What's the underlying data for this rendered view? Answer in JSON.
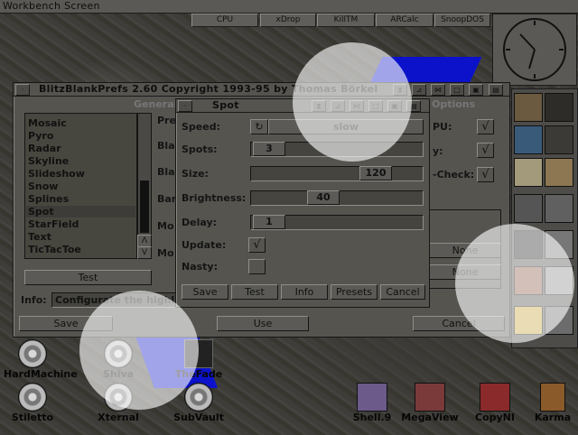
{
  "screen": {
    "title": "Workbench Screen"
  },
  "dock_buttons": [
    "CPU",
    "xDrop",
    "KillTM",
    "ARCalc",
    "SnoopDOS"
  ],
  "main_window": {
    "title": "BlitzBlankPrefs 2.60  Copyright 1993-95 by Thomas Börkel",
    "section_general": "General",
    "section_options": "Options",
    "modules": [
      "Mosaic",
      "Pyro",
      "Radar",
      "Skyline",
      "Slideshow",
      "Snow",
      "Splines",
      "Spot",
      "StarField",
      "Text",
      "TicTacToe"
    ],
    "selected_module": "Spot",
    "left_labels": [
      "Pre",
      "Bla",
      "Bla",
      "Ban",
      "Mo",
      "Mo"
    ],
    "test_label": "Test",
    "info_label": "Info:",
    "info_value": "Configurate the highl",
    "right_labels": [
      "PU:",
      "y:",
      "-Check:"
    ],
    "none_labels": [
      "None",
      "None"
    ],
    "save_label": "Save",
    "use_label": "Use",
    "cancel_label": "Cancel",
    "scroll_up": "Λ",
    "scroll_down": "V"
  },
  "spot_window": {
    "title": "Spot",
    "speed_label": "Speed:",
    "speed_value": "slow",
    "spots_label": "Spots:",
    "spots_value": "3",
    "size_label": "Size:",
    "size_value": "120",
    "brightness_label": "Brightness:",
    "brightness_value": "40",
    "delay_label": "Delay:",
    "delay_value": "1",
    "update_label": "Update:",
    "update_checked": "√",
    "nasty_label": "Nasty:",
    "buttons": [
      "Save",
      "Test",
      "Info",
      "Presets",
      "Cancel"
    ]
  },
  "desktop_icons": [
    {
      "label": "HardMachine"
    },
    {
      "label": "Shiva"
    },
    {
      "label": "TheFade"
    },
    {
      "label": "Stiletto"
    },
    {
      "label": "Xternal"
    },
    {
      "label": "SubVault"
    },
    {
      "label": "Shell.9"
    },
    {
      "label": "MegaView"
    },
    {
      "label": "CopyNI"
    },
    {
      "label": "Karma"
    }
  ],
  "colors": {
    "accent_blue": "#0b12c9",
    "window_gray": "#55544f"
  }
}
